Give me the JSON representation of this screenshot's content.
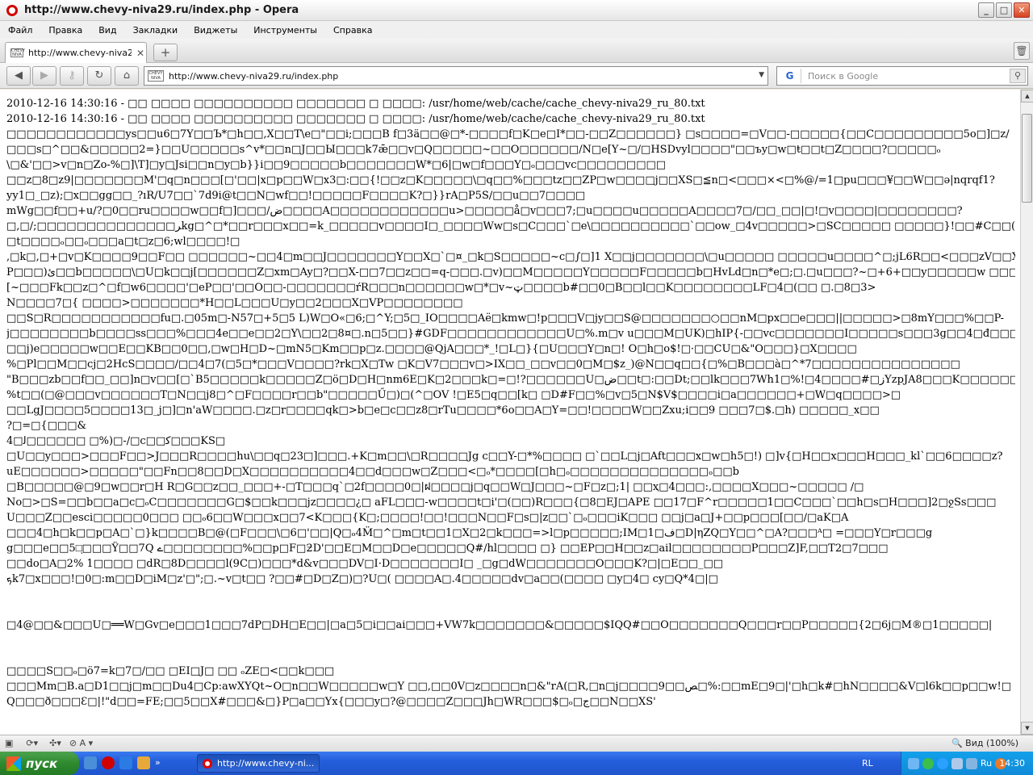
{
  "window": {
    "title": "http://www.chevy-niva29.ru/index.php - Opera",
    "min": "_",
    "max": "□",
    "close": "✕"
  },
  "menu": [
    "Файл",
    "Правка",
    "Вид",
    "Закладки",
    "Виджеты",
    "Инструменты",
    "Справка"
  ],
  "tab": {
    "label": "http://www.chevy-niva2...",
    "favicon_text": "CHEVY NIVA",
    "close": "✕"
  },
  "newtab": "+",
  "address": {
    "url": "http://www.chevy-niva29.ru/index.php",
    "badge": "CHEVY NIVA"
  },
  "search": {
    "engine": "G",
    "placeholder": "Поиск в Google"
  },
  "content_lines": [
    "2010-12-16 14:30:16 - □□ □□□□ □□□□□□□□□□ □□□□□□□ □ □□□□: /usr/home/web/cache/cache_chevy-niva29_ru_80.txt",
    "2010-12-16 14:30:16 - □□ □□□□ □□□□□□□□□□ □□□□□□□ □ □□□□: /usr/home/web/cache/cache_chevy-niva29_ru_80.txt",
    "□□□□□□□□□□□□ys□□u6□7Y□□Ъ*□h□□,X□□T\\e□\"□□i;□□□B f□3ä□□@□*-□□□□f□K□e□I*□□-□□Z□□□□□□} □s□□□□=□V□□-□□□□□{□□C□□□□□□□□□5o□]□z/",
    "□□□s□^□□&□□□□□2=}□□U□□□□□s^v*□□n□J□□Ы□□□k7ǣ□□v□Q□□□□□~□□O□□□□□□/N□e[Y~□/□HSDvyl□□□□\"□□ъy□w□ŧ□□t□Z□□□□?□□□□□ₒ",
    "\\□&'□□>v□n□Zo-%□]\\T]□y□Jsi□□n□y□b}}i□□9□□□□□b□□□□□□□W*□6|□w□f□□□Y□ₒ□□□vc□□□□□□□□□",
    "□□z□8□z9|□□□□□□□M'□q□n□□□[□'□□|x□p□□W□x3□:□□{!□□z□K□□□□□\\□q□□%□□□tz□□ZP□w□□□□j□□XS□≦n□<□□□×<□%@/=1□pu□□□¥□□W□□ə|nqrqf1?",
    "yy1□_□z);□x□□gg□□_?ıR/U7□□`7d9i@t□□N□wf□□!□□□□□F□□□□K?□}}rA□P5S/□□u□□7□□□□",
    "mWg□□f□□+u/?□0□□ru□□□□w□□f□]□□□/ض□□□□A□□□□□□□□□□□□u>□□□□□å□v□□□7;□u□□□□u□□□□□A□□□□7□/□□_□□|□!□v□□□□|□□□□□□□□?",
    "□,□/;□□□□□□□□□□□□□□ﺮkg□^□*□□r□□□x□□=k_□□□□□v□□□□I□_□□□□Ww□s□C□□□`□e\\□□□□□□□□□□`□□ow_□4v□□□□□>□SC□□□□□ □□□□□}!□□#C□□([□□□a□□□L□□□□",
    "□t□□□□ₒ□□ₒ□□□a□t□z□6;wl□□□□!□",
    ",□k□,□+□v□K□□□□9□□F□□ □□□□□□~□□4□m□□J□□□□□□□Y□□X□`□¤_□k□S□□□□□~c□∫□]1 X□□j□□□□□□□\\□u□□□□□ □□□□□u□□□□^□;jL6R□□<□□□zV□□X□-",
    "P□□□)ئ□□b□□□□□\\□U□k□□j[□□□□□□Z□xm□Ay□?□□X-□□7□□z□□=q-□□□.□v)□□M□□□□□Y□□□□□F□□□□□b□HvLd□n□*e□;□.□u□□□?~□+6+□□y□□□□□w □□□&",
    "[~□□□Fk□□z□^□f□w6□□□□'□eP□□'□□O□□-□□□□□□□ŕR□□□n□□□□□□w□*□v~ټ□□□□b#□□0□B□□l□□K□□□□□□□□LF□4□(□□ □.□8□3>",
    "N□□□□7□{ □□□□>□□□□□□□*H□□L□□□U□y□□2□□□X□VP□□□□□□□□",
    "□□S□R□□□□□□□□□□□fu□.□05m□-N57□+5□5 L)W□O«□6;□^Y;□5□_IO□□□□Aё□kmw□!p□□□V□jy□□S@□□□□□□□○□□nM□px□□e□□□||□□□□□>□8mY□□□%□□P-",
    "j□□□□□□□□b□□□□ss□□□%□□□4e□□e□□2□Y\\□□2□8¤□.n□5□□}#GDF□□□□□□□□□□□□U□%.m□v u□□□M□UK)□hIP{-□□vc□□□□□□□I□□□□□s□□□3g□□4□đ□□□□□□□□□?",
    "□□j)e□□□□□w□□E□□KB□□0□□,□w□H□D~□mN5□Km□□p□z.□□□□@QjA□□□*_!□L□}{□U□□□Y□n□! O□h□o$!□·□□CU□&\"O□□□}□X□□□□",
    "%□Pl□□M□□cj□2HcS□□□□/□□4□7(□5□*□□□V□□□□?rk□X□Tw □K□V7□□□v□>IX□□_□□v□□0□M□$z_)@N□□q□□{□%□B□□□à□^*7□□□□□□□□□□□□□□□",
    "\"B□□□zb□□f□□_□□]n□v□□[□`B5□□□□□k□□□□□Z□ö□D□H□nm6E□K□2□□□k□=□!?□□□□□□U□ض□□t□:□□Dt;□□lk□□□7Wh1□%!□4□□□□#□ﺯYzpJA8□□□K□□□□□□□□□□□□",
    "%t□□(□@□□□v□□□□□□T□N□□j8□^□F□□□□r□□b\"□□□□□Ű□)□(^□OV !□E5□q□□[k□ □D#F□□%□v□5□N$V$□□□□i□a□□□□□□+□W□q□□□□>□",
    "□□LgJ□□□□5□□□□13□_j□]□n'aW□□□□.□z□r□□□□qk□>b□e□c□□z8□rTu□□□□*6o□□A□Y=□□!□□□□W□□Zxu;i□□9 □□□7□$.□h) □□□□□_x□□",
    "?□=□{□□□&",
    "ﻟ□4□□□□□□ □%)□-/□c□□ﻛ□□□KS□",
    "□U□□y□□□>□□□F□□>J□□□R□□□□hu\\□□q□23□]□□□.+K□m□□\\□R□□□□Jg c□□Y-□*%□□□□ □`□□L□j□Aft□□□x□w□h5□!) □]v{□H□□x□□□H□□□_kl`□□6□□□□z?",
    "uE□□□□□□>□□□□□\"□□Fn□□8□□D□X□□□□□□□□□□4□□d□□□w□Z□□□<□ₒ*□□□□[□h□ₒ□□□□□□□□□□□□□□ₒ□□b",
    "□B□□□□□@□9□w□□r□H R□G□□z□□_□□□+-□T□□□q`□2f□□□□0□|ฝ□□□□j□q□□W□J□□□~□F□z□;1| □□ҳ□4□□□:,□□□□X□□□~□□□□□ /□",
    "No□>□S=□□b□□a□c□ₒC□□□□□□□G□$□□k□□□jz□□□□¿□ aFL□□□-w□□□□t□i'□(□□)R□□□{□8□EJ□APE □□17□F^r□□□□□1□□C□□□`□□h□s□H□□□]2□ջSs□□□",
    "U□□□Z□□esci□□□□□0□□□ □□ₒ6□□W□□□x□□7<K□□□{K□;□□□□!□□!□□□N□□F□s□|z□□`□ₒ□□□iK□□□ □□j□a□J+□□p□□□[□□/□aK□A",
    "□□□4□h□k□□p□A□`□}k□□□□B□@(□F□□□\\□6□'□□|Q□ₒ4M̈□^□m□t□□1□X□2□k□□□=>l□p□□□□□;IM□1□ف□D|ηZQ□Y□□^□A?□□□ᴬ□ =□□□Y□r□□□g",
    "g□□□e□□5□ͅ□□□Ÿ□□7Q ے□□□□□□□□%□□p□F□ƻD'□□E□M□□D□e□□□□□Q#/hl□□□□ □} □□EP□□H□□z□ail□□□□□□□□P□□□Z]F,□□T2□7□□□",
    "□□do□A□2% 1□□□□ □dR□8D□□□□l(9C□)□□□*d&v□□□DV□I·D□□□□□□□I□ _□g□dW□□□□□□□O□□□K?□|□E□□_□□",
    "ܟk7□x□□□!□0□:m□□D□iM□z'□\";□.~v□t□□ ?□□#□D□Z□)□?U□( □□□□A□.4□□□□□dv□a□□(□□□□ □y□4□ ϲy□Q*4□|□",
    "",
    "",
    "□4@□□&□□□U□══W□Gv□e□□□1□□□7dP□DH□E□□|□a□5□i□□ai□□□+VW7k□□□□□□□&□□□□□$IQQ#□□O□□□□□□□Q□□□r□□P□□□□□{2□6j□M®□1□□□□□|",
    "",
    "",
    "□□□□S□□ₒ□ö7=k□7□/□□ □EI□J□ □□ ₒZE□<□□k□□□",
    "□□□Mm□B.a□D1□□j□m□□Du4□Cp:awXYQt~O□n□□W□□□□□w□Y □□,□□0V□z□□□□n□&\"rA(□R,□n□j□□□□9□□ﺺ□%:□□mE□9□|'□h□k#□hN□□□□&V□l6k□□p□□w!□",
    "Q□□□ð□□□Ɛ□|!\"d□□=FE;□□5□□X#□□□&□}P□a□□Yx{□□□y□?@□□□□Z□□□Jh□WR□□□$□ₒ□ج□□N□□XS'"
  ],
  "scroll": {
    "up": "▲",
    "down": "▼",
    "position": 0.02
  },
  "status": {
    "zoom": "Вид (100%)"
  },
  "taskbar": {
    "start_label": "пуск",
    "task_label": "http://www.chevy-ni...",
    "lang": "RL",
    "tray_lang": "Ru",
    "clock": "14:30",
    "more": "»"
  },
  "colors": {
    "opera_red": "#d10000",
    "taskbar_blue": "#245edb",
    "start_green": "#2f8a2f"
  }
}
